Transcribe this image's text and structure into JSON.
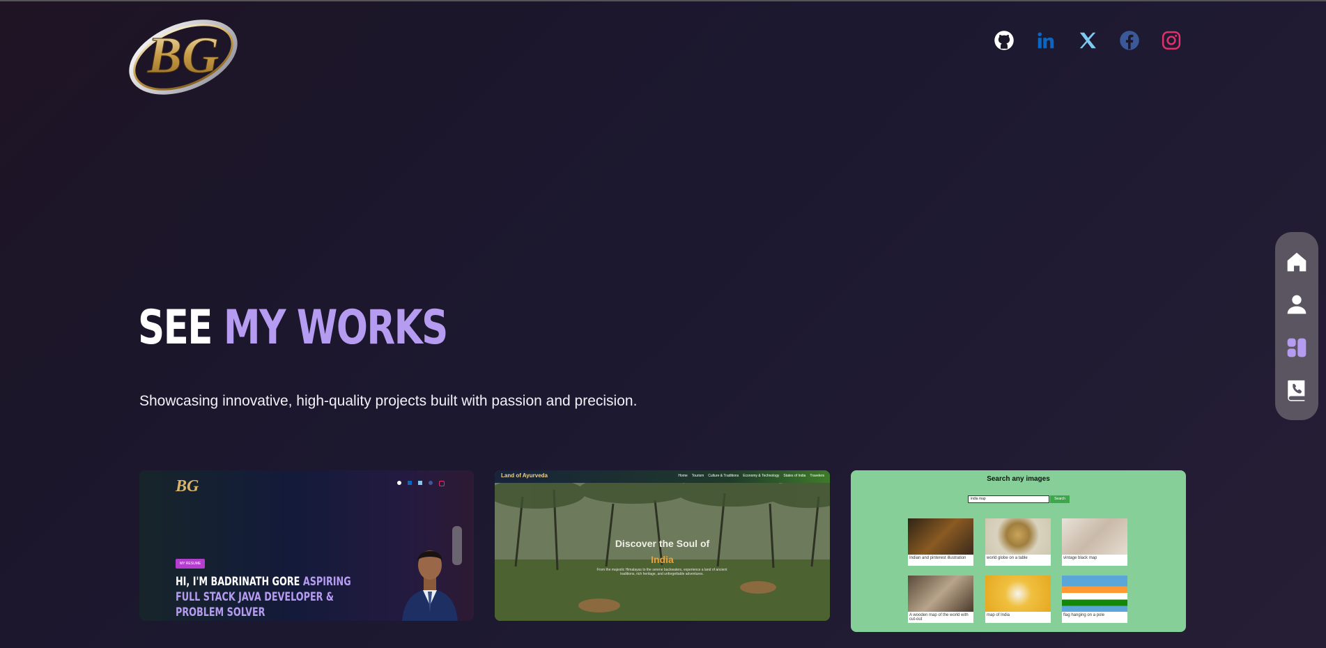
{
  "logo": {
    "letters": "BG"
  },
  "socials": [
    {
      "name": "github",
      "color": "#ffffff"
    },
    {
      "name": "linkedin",
      "color": "#0a66c2"
    },
    {
      "name": "x",
      "color": "#7fc8f0"
    },
    {
      "name": "facebook",
      "color": "#3b5998"
    },
    {
      "name": "instagram",
      "color": "#e1306c"
    }
  ],
  "side_nav": [
    "home-icon",
    "user-icon",
    "dashboard-icon",
    "contact-book-icon"
  ],
  "hero": {
    "heading_plain": "SEE ",
    "heading_accent": "MY WORKS",
    "subtitle": "Showcasing innovative, high-quality projects built with passion and precision."
  },
  "projects": {
    "portfolio": {
      "logo": "BG",
      "badge": "MY RESUME",
      "line1_plain": "HI, I'M BADRINATH GORE ",
      "line1_accent": "ASPIRING",
      "line2": "FULL STACK JAVA DEVELOPER &",
      "line3": "PROBLEM SOLVER"
    },
    "ayurveda": {
      "brand": "Land of Ayurveda",
      "nav": [
        "Home",
        "Tourism",
        "Culture & Traditions",
        "Economy & Technology",
        "States of India",
        "Travelers"
      ],
      "headline": "Discover the Soul of",
      "headline_accent": "India",
      "blurb": "From the majestic Himalayas to the serene backwaters, experience a land of ancient traditions, rich heritage, and unforgettable adventures."
    },
    "image_search": {
      "title": "Search any images",
      "query": "india map",
      "button": "Search",
      "captions": [
        "Indian and pinterest illustration",
        "world globe on a table",
        "vintage black map",
        "A wooden map of the world with cut-out",
        "map of India",
        "flag hanging on a pole"
      ]
    }
  },
  "colors": {
    "accent": "#b69cf0",
    "nav_bg": "#5a5560",
    "search_bg": "#86cf98"
  }
}
